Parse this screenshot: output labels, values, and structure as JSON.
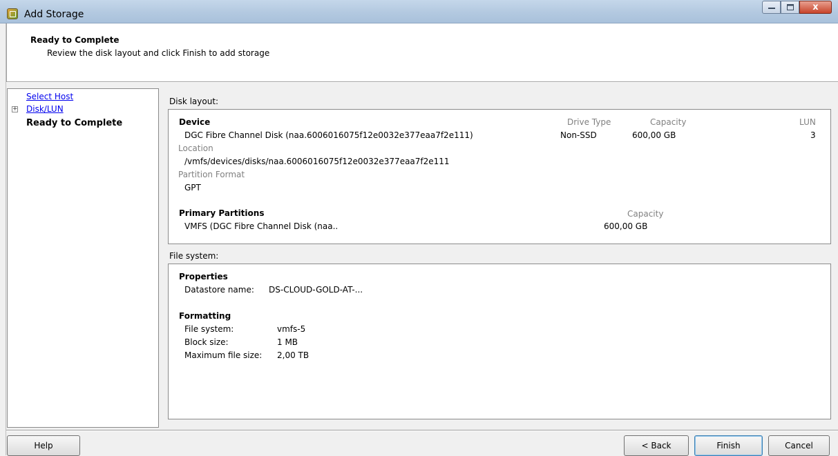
{
  "window": {
    "title": "Add Storage",
    "close_glyph": "x"
  },
  "header": {
    "title": "Ready to Complete",
    "subtitle": "Review the disk layout and click Finish to add storage"
  },
  "nav": {
    "items": [
      {
        "label": "Select Host"
      },
      {
        "label": "Disk/LUN",
        "expander": "+"
      },
      {
        "label": "Ready to Complete"
      }
    ]
  },
  "disk_layout": {
    "section_label": "Disk layout:",
    "device_heading": "Device",
    "drive_type_header": "Drive Type",
    "capacity_header": "Capacity",
    "lun_header": "LUN",
    "device_name": "DGC Fibre Channel Disk (naa.6006016075f12e0032e377eaa7f2e111)",
    "drive_type": "Non-SSD",
    "capacity": "600,00 GB",
    "lun": "3",
    "location_label": "Location",
    "location": "/vmfs/devices/disks/naa.6006016075f12e0032e377eaa7f2e111",
    "partition_format_label": "Partition Format",
    "partition_format": "GPT",
    "primary_partitions_heading": "Primary Partitions",
    "partition_capacity_header": "Capacity",
    "partition_name": "VMFS (DGC Fibre Channel Disk (naa..",
    "partition_capacity": "600,00 GB"
  },
  "file_system": {
    "section_label": "File system:",
    "properties_heading": "Properties",
    "datastore_label": "Datastore name:",
    "datastore_value": "DS-CLOUD-GOLD-AT-...",
    "formatting_heading": "Formatting",
    "fs_label": "File system:",
    "fs_value": "vmfs-5",
    "block_label": "Block size:",
    "block_value": "1 MB",
    "maxfile_label": "Maximum file size:",
    "maxfile_value": "2,00 TB"
  },
  "buttons": {
    "help": "Help",
    "back": "< Back",
    "finish": "Finish",
    "cancel": "Cancel"
  }
}
